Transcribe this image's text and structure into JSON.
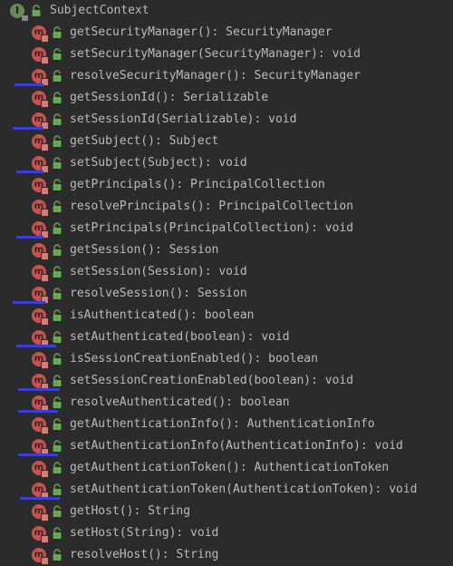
{
  "header": {
    "icon_letter": "I",
    "title": "SubjectContext"
  },
  "icons": {
    "method_letter": "m",
    "interface_color": "#6a8759",
    "method_color": "#c75450",
    "public_lock_color": "#6aa84f",
    "annotation_color": "#3a3fd6"
  },
  "methods": [
    {
      "label": "getSecurityManager(): SecurityManager"
    },
    {
      "label": "setSecurityManager(SecurityManager): void"
    },
    {
      "label": "resolveSecurityManager(): SecurityManager"
    },
    {
      "label": "getSessionId(): Serializable"
    },
    {
      "label": "setSessionId(Serializable): void"
    },
    {
      "label": "getSubject(): Subject"
    },
    {
      "label": "setSubject(Subject): void"
    },
    {
      "label": "getPrincipals(): PrincipalCollection"
    },
    {
      "label": "resolvePrincipals(): PrincipalCollection"
    },
    {
      "label": "setPrincipals(PrincipalCollection): void"
    },
    {
      "label": "getSession(): Session"
    },
    {
      "label": "setSession(Session): void"
    },
    {
      "label": "resolveSession(): Session"
    },
    {
      "label": "isAuthenticated(): boolean"
    },
    {
      "label": "setAuthenticated(boolean): void"
    },
    {
      "label": "isSessionCreationEnabled(): boolean"
    },
    {
      "label": "setSessionCreationEnabled(boolean): void"
    },
    {
      "label": "resolveAuthenticated(): boolean"
    },
    {
      "label": "getAuthenticationInfo(): AuthenticationInfo"
    },
    {
      "label": "setAuthenticationInfo(AuthenticationInfo): void"
    },
    {
      "label": "getAuthenticationToken(): AuthenticationToken"
    },
    {
      "label": "setAuthenticationToken(AuthenticationToken): void"
    },
    {
      "label": "getHost(): String"
    },
    {
      "label": "setHost(String): void"
    },
    {
      "label": "resolveHost(): String"
    }
  ]
}
